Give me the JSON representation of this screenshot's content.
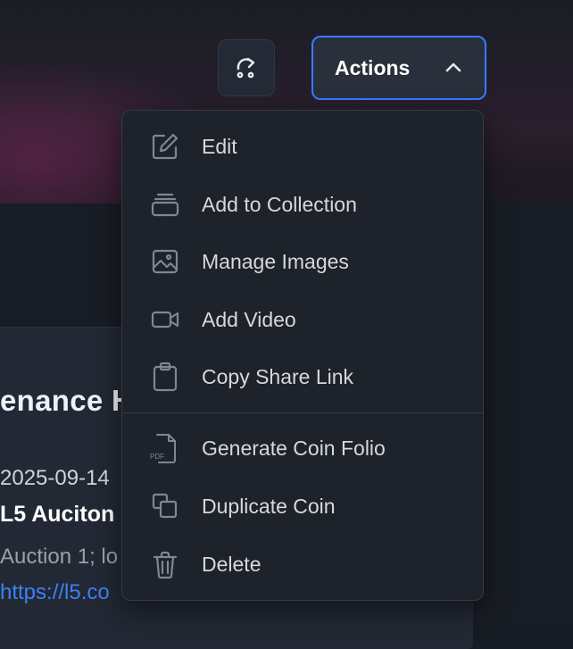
{
  "toolbar": {
    "actions_label": "Actions"
  },
  "card": {
    "title_fragment": "enance H",
    "date_fragment": "2025-09-14",
    "source_fragment": "L5 Auciton",
    "note_fragment": "Auction 1; lo",
    "link_fragment": "https://l5.co"
  },
  "menu": {
    "items": [
      {
        "label": "Edit",
        "icon": "pencil-square-icon"
      },
      {
        "label": "Add to Collection",
        "icon": "collection-icon"
      },
      {
        "label": "Manage Images",
        "icon": "image-icon"
      },
      {
        "label": "Add Video",
        "icon": "video-camera-icon"
      },
      {
        "label": "Copy Share Link",
        "icon": "clipboard-icon"
      },
      {
        "label": "Generate Coin Folio",
        "icon": "pdf-file-icon"
      },
      {
        "label": "Duplicate Coin",
        "icon": "duplicate-icon"
      },
      {
        "label": "Delete",
        "icon": "trash-icon"
      }
    ]
  },
  "colors": {
    "accent": "#3d7bf6",
    "link": "#3b82f6",
    "menu_bg": "#1d222b"
  }
}
